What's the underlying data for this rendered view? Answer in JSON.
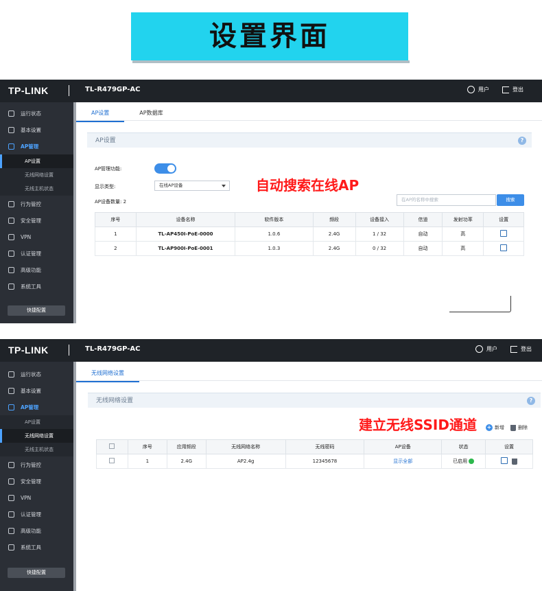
{
  "banner": {
    "title": "设置界面"
  },
  "brand": {
    "logo": "TP-LINK",
    "model": "TL-R479GP-AC",
    "user": "用户",
    "logout": "登出"
  },
  "sidebar": {
    "items": [
      "运行状态",
      "基本设置",
      "AP管理",
      "行为管控",
      "安全管理",
      "VPN",
      "认证管理",
      "高级功能",
      "系统工具"
    ],
    "subitems": [
      "AP设置",
      "无线网络设置",
      "无线主机状态"
    ],
    "quick": "快捷配置"
  },
  "screen1": {
    "tabs": [
      "AP设置",
      "AP数据库"
    ],
    "section": "AP设置",
    "ap_mgmt_label": "AP管理功能:",
    "display_type_label": "显示类型:",
    "display_type_value": "在线AP设备",
    "count_label": "AP设备数量: 2",
    "search_placeholder": "在AP的名称中搜索",
    "search_btn": "搜索",
    "note": "自动搜索在线AP",
    "headers": [
      "序号",
      "设备名称",
      "软件版本",
      "频段",
      "设备接入",
      "信道",
      "发射功率",
      "设置"
    ],
    "rows": [
      [
        "1",
        "TL-AP450I-PoE-0000",
        "1.0.6",
        "2.4G",
        "1 / 32",
        "自动",
        "高"
      ],
      [
        "2",
        "TL-AP900I-PoE-0001",
        "1.0.3",
        "2.4G",
        "0 / 32",
        "自动",
        "高"
      ]
    ]
  },
  "screen2": {
    "tab": "无线网络设置",
    "section": "无线网络设置",
    "note": "建立无线SSID通道",
    "add": "新增",
    "delete": "删除",
    "headers": [
      "序号",
      "应用频段",
      "无线网络名称",
      "无线密码",
      "AP设备",
      "状态",
      "设置"
    ],
    "rows": [
      [
        "1",
        "2.4G",
        "AP2.4g",
        "12345678",
        "显示全部",
        "已启用"
      ]
    ]
  },
  "colors": {
    "accent": "#1f6fd1",
    "banner": "#22d3ee",
    "note": "#ff1a1a",
    "topbar": "#1f2328",
    "sidebar": "#2b2f36"
  }
}
